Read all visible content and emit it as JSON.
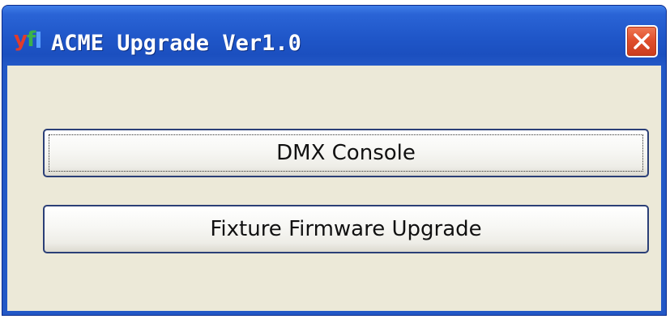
{
  "window": {
    "title": "ACME Upgrade Ver1.0",
    "icon": "yf-app-icon",
    "close_icon": "close-icon"
  },
  "buttons": {
    "dmx_console": "DMX Console",
    "fixture_firmware_upgrade": "Fixture Firmware Upgrade"
  },
  "colors": {
    "titlebar": "#2358c6",
    "client_background": "#ece9d8",
    "close_button": "#e0502e",
    "button_border": "#2b3f77"
  }
}
